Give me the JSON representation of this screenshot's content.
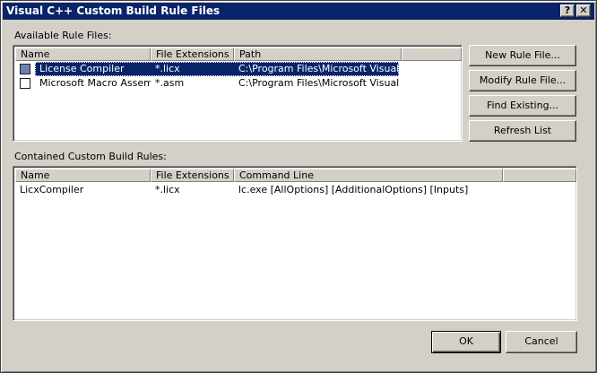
{
  "window": {
    "title": "Visual C++ Custom Build Rule Files",
    "help_glyph": "?",
    "close_glyph": "✕"
  },
  "available": {
    "label": "Available Rule Files:",
    "columns": [
      "Name",
      "File Extensions",
      "Path"
    ],
    "rows": [
      {
        "checked": true,
        "selected": true,
        "name": "License Compiler",
        "ext": "*.licx",
        "path": "C:\\Program Files\\Microsoft Visual ..."
      },
      {
        "checked": false,
        "selected": false,
        "name": "Microsoft Macro Assem...",
        "ext": "*.asm",
        "path": "C:\\Program Files\\Microsoft Visual ..."
      }
    ]
  },
  "contained": {
    "label": "Contained Custom Build Rules:",
    "columns": [
      "Name",
      "File Extensions",
      "Command Line"
    ],
    "rows": [
      {
        "name": "LicxCompiler",
        "ext": "*.licx",
        "cmd": "lc.exe [AllOptions] [AdditionalOptions] [Inputs]"
      }
    ]
  },
  "buttons": {
    "new_rule": "New Rule File...",
    "modify_rule": "Modify Rule File...",
    "find_existing": "Find Existing...",
    "refresh": "Refresh List",
    "ok": "OK",
    "cancel": "Cancel"
  },
  "colors": {
    "face": "#d4d0c8",
    "title_bar": "#0a246a",
    "selection": "#0a246a"
  }
}
